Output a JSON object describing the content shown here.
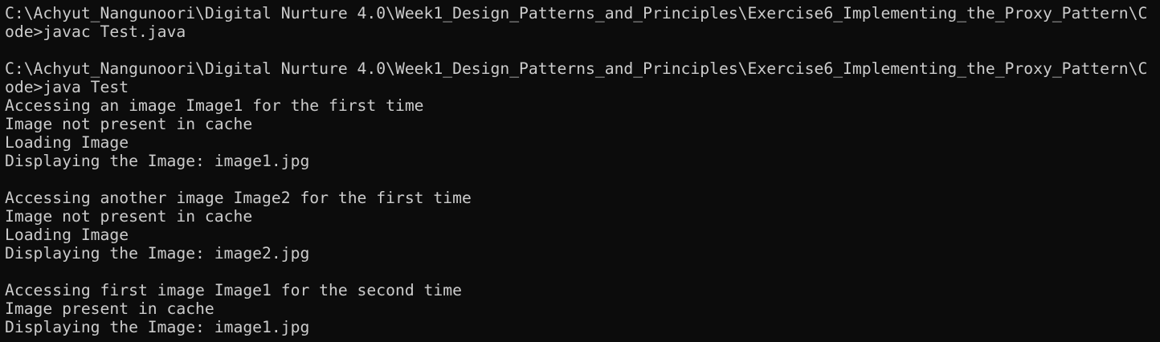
{
  "terminal": {
    "lines": [
      "C:\\Achyut_Nangunoori\\Digital Nurture 4.0\\Week1_Design_Patterns_and_Principles\\Exercise6_Implementing_the_Proxy_Pattern\\C",
      "ode>javac Test.java",
      "",
      "C:\\Achyut_Nangunoori\\Digital Nurture 4.0\\Week1_Design_Patterns_and_Principles\\Exercise6_Implementing_the_Proxy_Pattern\\C",
      "ode>java Test",
      "Accessing an image Image1 for the first time",
      "Image not present in cache",
      "Loading Image",
      "Displaying the Image: image1.jpg",
      "",
      "Accessing another image Image2 for the first time",
      "Image not present in cache",
      "Loading Image",
      "Displaying the Image: image2.jpg",
      "",
      "Accessing first image Image1 for the second time",
      "Image present in cache",
      "Displaying the Image: image1.jpg"
    ]
  }
}
